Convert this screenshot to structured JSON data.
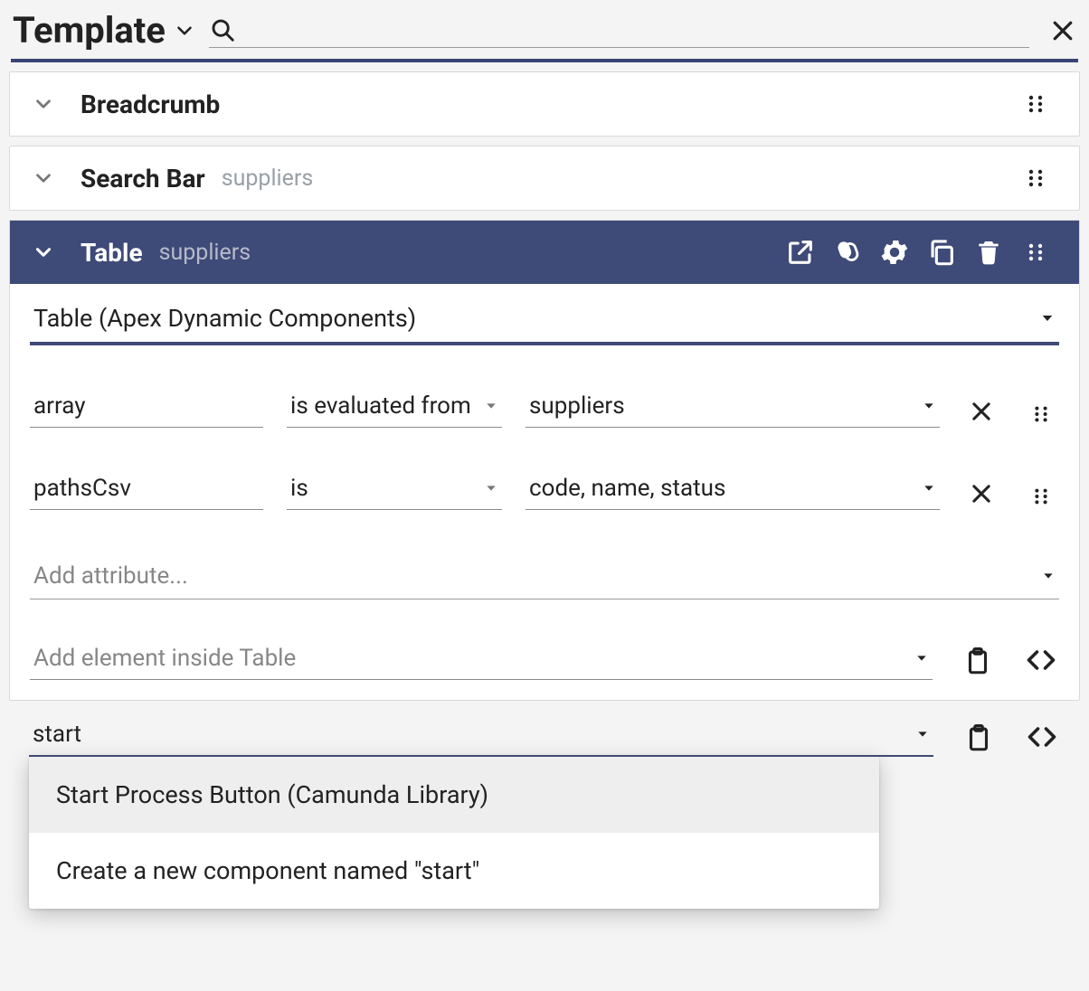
{
  "header": {
    "title": "Template"
  },
  "items": [
    {
      "title": "Breadcrumb",
      "subtitle": ""
    },
    {
      "title": "Search Bar",
      "subtitle": "suppliers"
    },
    {
      "title": "Table",
      "subtitle": "suppliers"
    }
  ],
  "table": {
    "component": "Table (Apex Dynamic Components)",
    "attributes": [
      {
        "name": "array",
        "operator": "is evaluated from",
        "value": "suppliers"
      },
      {
        "name": "pathsCsv",
        "operator": "is",
        "value": "code, name, status"
      }
    ],
    "add_attribute_placeholder": "Add attribute...",
    "add_inside_placeholder": "Add element inside Table"
  },
  "autocomplete": {
    "query": "start",
    "options": [
      "Start Process Button (Camunda Library)",
      "Create a new component named \"start\""
    ]
  }
}
